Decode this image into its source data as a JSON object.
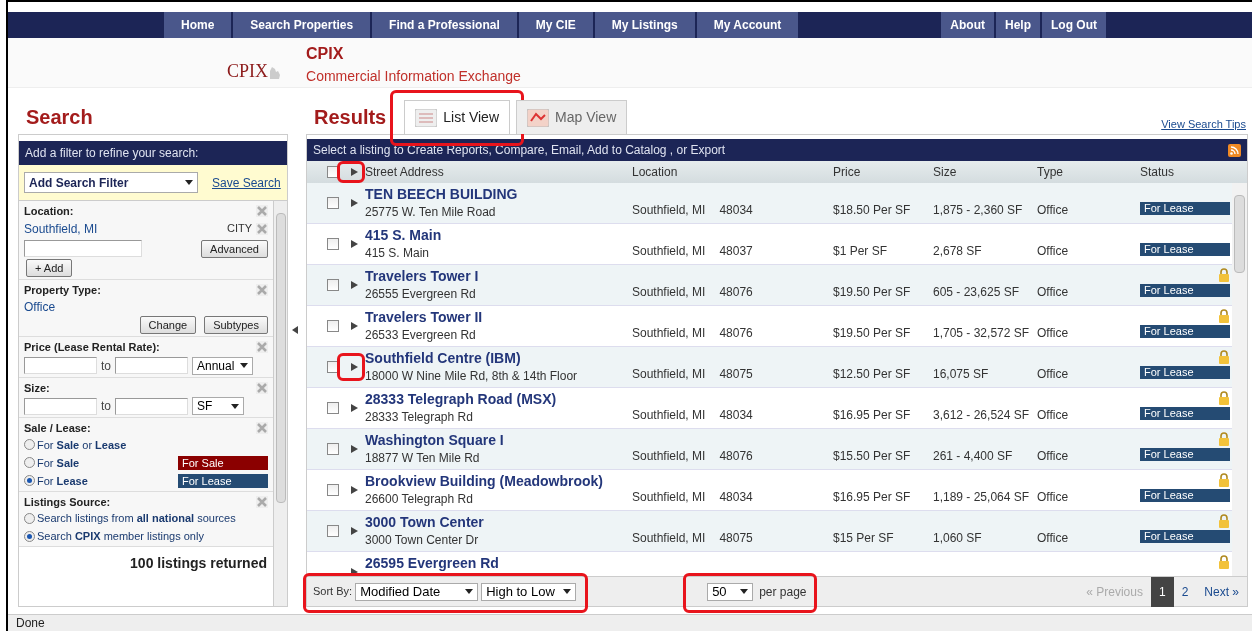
{
  "nav": {
    "left": [
      {
        "label": "Home"
      },
      {
        "label": "Search Properties"
      },
      {
        "label": "Find a Professional"
      },
      {
        "label": "My CIE"
      },
      {
        "label": "My Listings"
      },
      {
        "label": "My Account"
      }
    ],
    "right": [
      {
        "label": "About"
      },
      {
        "label": "Help"
      },
      {
        "label": "Log Out"
      }
    ]
  },
  "header": {
    "logo": "CPIX",
    "title": "CPIX",
    "subtitle": "Commercial Information Exchange"
  },
  "search": {
    "title": "Search",
    "prompt": "Add a filter to refine your search:",
    "add_filter": "Add Search Filter",
    "save_search": "Save Search",
    "filters": [
      {
        "kind": "location",
        "label": "Location:",
        "value": "Southfield, MI",
        "tag": "CITY",
        "buttons": [
          "Advanced",
          "+ Add"
        ]
      },
      {
        "kind": "type",
        "label": "Property Type:",
        "value": "Office",
        "buttons": [
          "Change",
          "Subtypes"
        ]
      },
      {
        "kind": "range",
        "label": "Price (Lease Rental Rate):",
        "to": "to",
        "unit": "Annual"
      },
      {
        "kind": "range",
        "label": "Size:",
        "to": "to",
        "unit": "SF"
      },
      {
        "kind": "options",
        "label": "Sale / Lease:",
        "options": [
          {
            "label": "For **Sale** or **Lease**",
            "selected": false
          },
          {
            "label": "For **Sale**",
            "selected": false,
            "badge": "For Sale",
            "color": "#8b0000"
          },
          {
            "label": "For **Lease**",
            "selected": true,
            "badge": "For Lease",
            "color": "#254b73"
          }
        ]
      },
      {
        "kind": "options",
        "label": "Listings Source:",
        "options": [
          {
            "label": "Search listings from **all national** sources",
            "selected": false
          },
          {
            "label": "Search **CPIX** member listings only",
            "selected": true
          }
        ]
      }
    ],
    "listings_returned": "100 listings returned"
  },
  "results": {
    "title": "Results",
    "view_tips": "View Search Tips",
    "tabs": [
      {
        "label": "List View",
        "selected": true,
        "highlighted": true
      },
      {
        "label": "Map View",
        "selected": false,
        "highlighted": false
      }
    ],
    "toolbar": "Select a listing to Create Reports, Compare, Email, Add to Catalog , or Export",
    "expand_highlighted": true,
    "select_all_checked": false,
    "columns": [
      "Street Address",
      "Location",
      "Price",
      "Size",
      "Type",
      "Status"
    ],
    "rows": [
      {
        "checked": false,
        "title": "TEN BEECH BUILDING",
        "address": "25775 W. Ten Mile Road",
        "city": "Southfield, MI",
        "zip": "48034",
        "price": "$18.50 Per SF",
        "size": "1,875 - 2,360 SF",
        "type": "Office",
        "status": "For Lease",
        "locked": false,
        "highlighted": false
      },
      {
        "checked": false,
        "title": "415 S. Main",
        "address": "415 S. Main",
        "city": "Southfield, MI",
        "zip": "48037",
        "price": "$1 Per SF",
        "size": "2,678 SF",
        "type": "Office",
        "status": "For Lease",
        "locked": false,
        "highlighted": false
      },
      {
        "checked": false,
        "title": "Travelers Tower I",
        "address": "26555 Evergreen Rd",
        "city": "Southfield, MI",
        "zip": "48076",
        "price": "$19.50 Per SF",
        "size": "605 - 23,625 SF",
        "type": "Office",
        "status": "For Lease",
        "locked": true,
        "highlighted": false
      },
      {
        "checked": false,
        "title": "Travelers Tower II",
        "address": "26533 Evergreen Rd",
        "city": "Southfield, MI",
        "zip": "48076",
        "price": "$19.50 Per SF",
        "size": "1,705 - 32,572 SF",
        "type": "Office",
        "status": "For Lease",
        "locked": true,
        "highlighted": false
      },
      {
        "checked": false,
        "title": "Southfield Centre (IBM)",
        "address": "18000 W Nine Mile Rd, 8th & 14th Floor",
        "city": "Southfield, MI",
        "zip": "48075",
        "price": "$12.50 Per SF",
        "size": "16,075 SF",
        "type": "Office",
        "status": "For Lease",
        "locked": true,
        "highlighted": true
      },
      {
        "checked": false,
        "title": "28333 Telegraph Road (MSX)",
        "address": "28333 Telegraph Rd",
        "city": "Southfield, MI",
        "zip": "48034",
        "price": "$16.95 Per SF",
        "size": "3,612 - 26,524 SF",
        "type": "Office",
        "status": "For Lease",
        "locked": true,
        "highlighted": false
      },
      {
        "checked": false,
        "title": "Washington Square I",
        "address": "18877 W Ten Mile Rd",
        "city": "Southfield, MI",
        "zip": "48076",
        "price": "$15.50 Per SF",
        "size": "261 - 4,400 SF",
        "type": "Office",
        "status": "For Lease",
        "locked": true,
        "highlighted": false
      },
      {
        "checked": false,
        "title": "Brookview Building (Meadowbrook)",
        "address": "26600 Telegraph Rd",
        "city": "Southfield, MI",
        "zip": "48034",
        "price": "$16.95 Per SF",
        "size": "1,189 - 25,064 SF",
        "type": "Office",
        "status": "For Lease",
        "locked": true,
        "highlighted": false
      },
      {
        "checked": false,
        "title": "3000 Town Center",
        "address": "3000 Town Center Dr",
        "city": "Southfield, MI",
        "zip": "48075",
        "price": "$15 Per SF",
        "size": "1,060 SF",
        "type": "Office",
        "status": "For Lease",
        "locked": true,
        "highlighted": false
      },
      {
        "title": "26595 Evergreen Rd",
        "locked": true,
        "highlighted": false
      }
    ],
    "sort": {
      "label": "Sort By:",
      "field": "Modified Date",
      "order": "High to Low",
      "highlighted": true
    },
    "per_page": {
      "value": "50",
      "label": "per page",
      "highlighted": true
    },
    "pagination": {
      "previous": "« Previous",
      "previous_disabled": true,
      "next": "Next »",
      "pages": [
        {
          "label": "1",
          "selected": true
        },
        {
          "label": "2",
          "selected": false
        }
      ]
    }
  },
  "status_bar": "Done"
}
